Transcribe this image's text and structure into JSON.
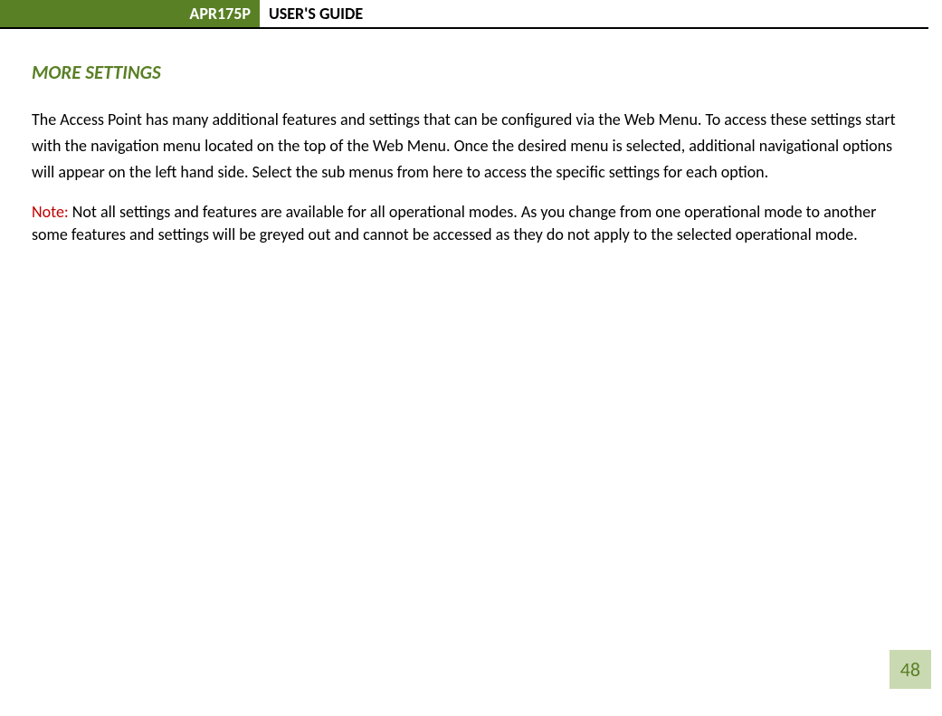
{
  "header": {
    "model": "APR175P",
    "title": "USER'S GUIDE"
  },
  "section": {
    "heading": "MORE SETTINGS"
  },
  "body": {
    "para1": "The Access Point has many additional features and settings that can be configured via the Web Menu.  To access these settings start with the navigation menu located on the top of the Web Menu.  Once the desired menu is selected, additional navigational options will appear on the left hand side.  Select the sub menus from here to access the specific settings for each option.",
    "note_label": "Note:",
    "note_text": " Not all settings and features are available for all operational modes.  As you change from one operational mode to another some features and settings will be greyed out and cannot be accessed as they do not apply to the selected operational mode."
  },
  "page_number": "48"
}
